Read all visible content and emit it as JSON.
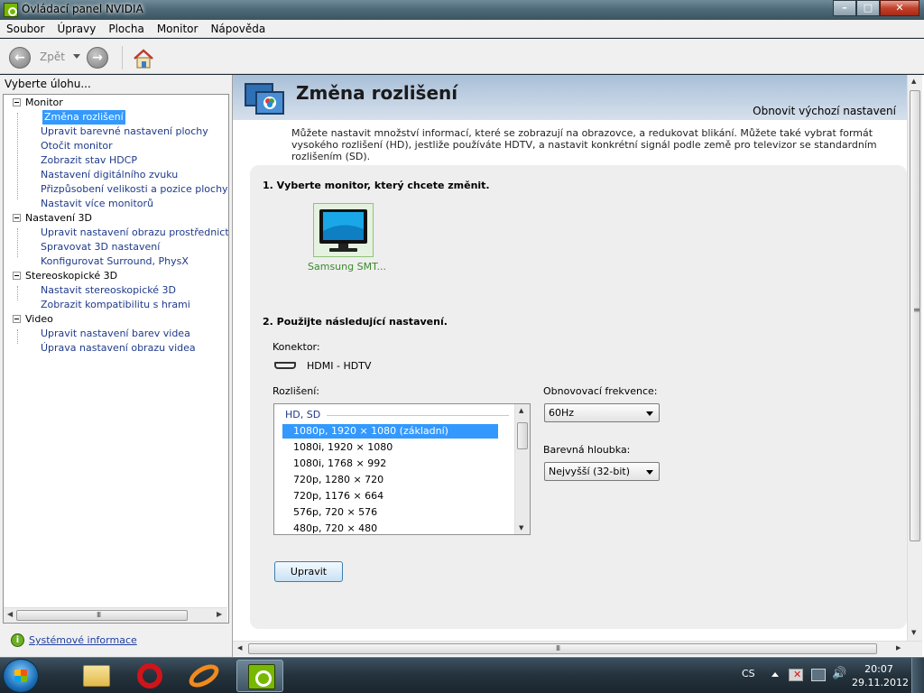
{
  "window": {
    "title": "Ovládací panel NVIDIA",
    "buttons": {
      "minimize": "–",
      "maximize": "□",
      "close": "✕"
    }
  },
  "menu": [
    "Soubor",
    "Úpravy",
    "Plocha",
    "Monitor",
    "Nápověda"
  ],
  "toolbar": {
    "back_label": "Zpět",
    "back_glyph": "←",
    "forward_glyph": "→"
  },
  "left_pane": {
    "task_label": "Vyberte úlohu...",
    "tree": [
      {
        "label": "Monitor",
        "items": [
          "Změna rozlišení",
          "Upravit barevné nastavení plochy",
          "Otočit monitor",
          "Zobrazit stav HDCP",
          "Nastavení digitálního zvuku",
          "Přizpůsobení velikosti a pozice plochy",
          "Nastavit více monitorů"
        ]
      },
      {
        "label": "Nastavení 3D",
        "items": [
          "Upravit nastavení obrazu prostřednictvím n",
          "Spravovat 3D nastavení",
          "Konfigurovat Surround, PhysX"
        ]
      },
      {
        "label": "Stereoskopické 3D",
        "items": [
          "Nastavit stereoskopické 3D",
          "Zobrazit kompatibilitu s hrami"
        ]
      },
      {
        "label": "Video",
        "items": [
          "Upravit nastavení barev videa",
          "Úprava nastavení obrazu videa"
        ]
      }
    ],
    "selected_item": "Změna rozlišení",
    "system_info_link": "Systémové informace",
    "scroll_grip": "III"
  },
  "main": {
    "title": "Změna rozlišení",
    "restore_defaults": "Obnovit výchozí nastavení",
    "description": "Můžete nastavit množství informací, které se zobrazují na obrazovce, a redukovat blikání. Můžete také vybrat formát vysokého rozlišení (HD), jestliže používáte HDTV, a nastavit konkrétní signál podle země pro televizor se standardním rozlišením (SD).",
    "section1_title": "1. Vyberte monitor, který chcete změnit.",
    "monitor_name": "Samsung SMT...",
    "section2_title": "2. Použijte následující nastavení.",
    "connector_label": "Konektor:",
    "connector_value": "HDMI - HDTV",
    "resolution_label": "Rozlišení:",
    "resolution_group": "HD, SD",
    "resolutions": [
      "1080p, 1920 × 1080 (základní)",
      "1080i, 1920 × 1080",
      "1080i, 1768 × 992",
      "720p, 1280 × 720",
      "720p, 1176 × 664",
      "576p, 720 × 576",
      "480p, 720 × 480"
    ],
    "selected_resolution": "1080p, 1920 × 1080 (základní)",
    "refresh_label": "Obnovovací frekvence:",
    "refresh_value": "60Hz",
    "color_depth_label": "Barevná hloubka:",
    "color_depth_value": "Nejvyšší (32-bit)",
    "apply_button": "Upravit",
    "scroll_grip": "III"
  },
  "taskbar": {
    "language": "CS",
    "time": "20:07",
    "date": "29.11.2012",
    "apps": [
      "explorer-folder",
      "opera",
      "ring-app",
      "nvidia-control-panel"
    ],
    "active_app": "nvidia-control-panel"
  }
}
